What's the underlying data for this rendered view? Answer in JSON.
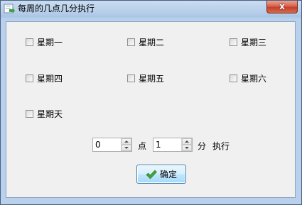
{
  "window": {
    "title": "每周的几点几分执行",
    "close_label": "x"
  },
  "weekdays": [
    {
      "label": "星期一",
      "checked": false
    },
    {
      "label": "星期二",
      "checked": false
    },
    {
      "label": "星期三",
      "checked": false
    },
    {
      "label": "星期四",
      "checked": false
    },
    {
      "label": "星期五",
      "checked": false
    },
    {
      "label": "星期六",
      "checked": false
    },
    {
      "label": "星期天",
      "checked": false
    }
  ],
  "time": {
    "hour_value": "0",
    "hour_unit": "点",
    "minute_value": "1",
    "minute_unit": "分",
    "suffix": "执行"
  },
  "ok_button": {
    "label": "确定",
    "icon": "check-icon",
    "icon_color": "#3fa33a"
  }
}
